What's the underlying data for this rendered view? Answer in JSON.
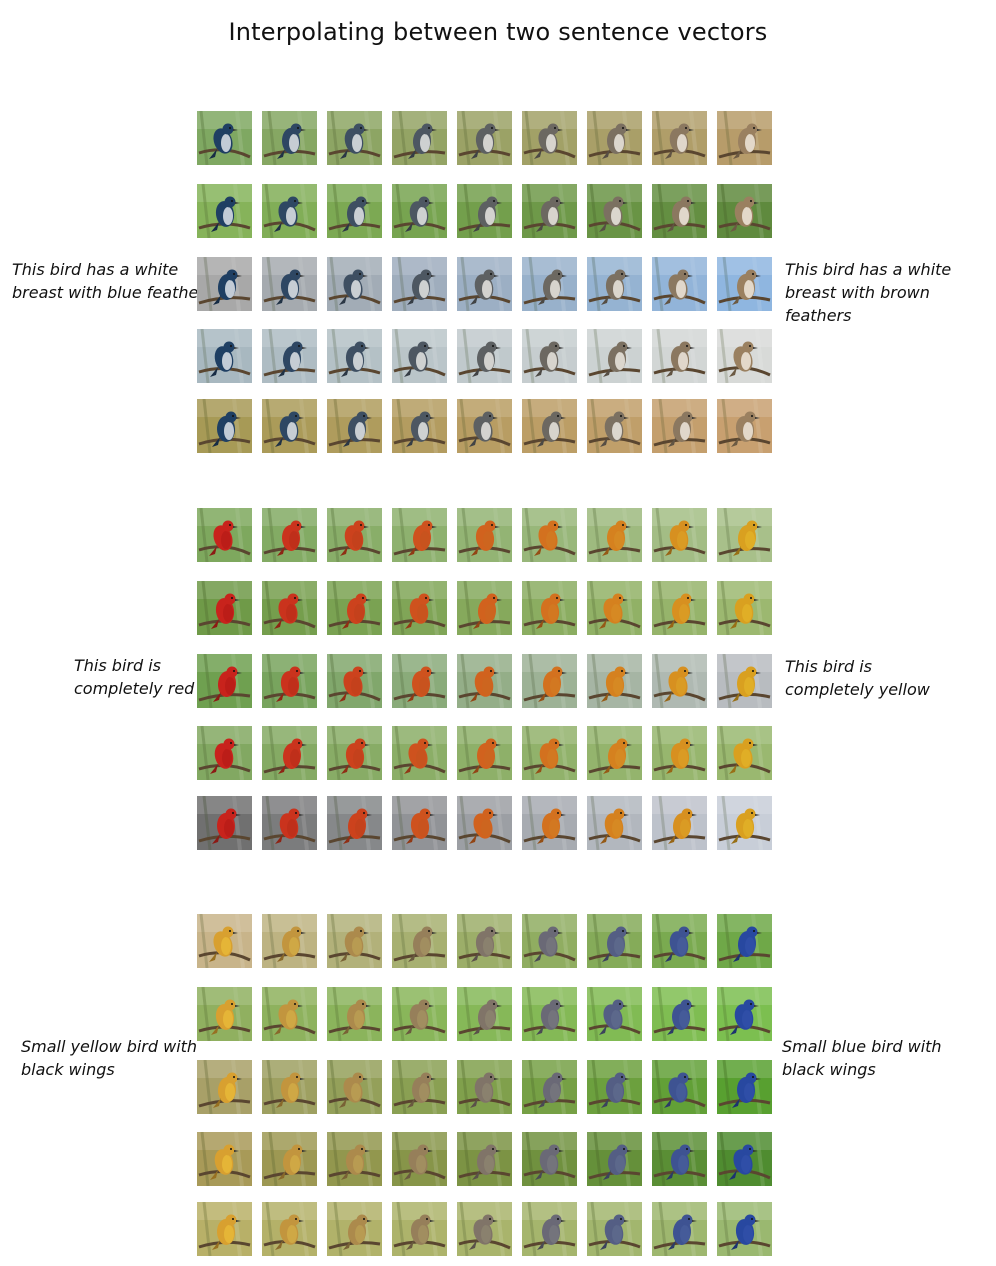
{
  "figure": {
    "title": "Interpolating between two sentence vectors"
  },
  "blocks": [
    {
      "left_label": "This bird has a white\nbreast with blue feathers",
      "right_label": "This bird has a white\nbreast with brown feathers",
      "steps": 9,
      "rows": 5,
      "bird_colors": [
        "#1f3f63",
        "#9a8060"
      ],
      "breast_colors": [
        "#dfe4ea",
        "#f0e8dc"
      ],
      "background_rows": [
        [
          "#7fa862",
          "#b79c6a"
        ],
        [
          "#86b35a",
          "#5f8a3e"
        ],
        [
          "#a8a8a8",
          "#8fb6e0"
        ],
        [
          "#a8b8c0",
          "#d8dad8"
        ],
        [
          "#a79a56",
          "#c8a070"
        ]
      ]
    },
    {
      "left_label": "This bird is\ncompletely red",
      "right_label": "This bird is\ncompletely yellow",
      "steps": 9,
      "rows": 5,
      "bird_colors": [
        "#c8231c",
        "#d9a020"
      ],
      "breast_colors": [
        "#b81c18",
        "#e0b028"
      ],
      "background_rows": [
        [
          "#7ea85e",
          "#a8c08a"
        ],
        [
          "#6f9a48",
          "#9cb870"
        ],
        [
          "#6fa050",
          "#b8bcc0"
        ],
        [
          "#82a862",
          "#9ab870"
        ],
        [
          "#707070",
          "#c8ced8"
        ]
      ]
    },
    {
      "left_label": "Small yellow bird with\nblack wings",
      "right_label": "Small blue bird with\nblack wings",
      "steps": 9,
      "rows": 5,
      "bird_colors": [
        "#d8a030",
        "#2848a0"
      ],
      "breast_colors": [
        "#e8b838",
        "#3050a8"
      ],
      "background_rows": [
        [
          "#c8b48a",
          "#6fa848"
        ],
        [
          "#90b060",
          "#7cbf50"
        ],
        [
          "#a8a068",
          "#58a030"
        ],
        [
          "#a89a58",
          "#4f8c30"
        ],
        [
          "#b8b068",
          "#9ab870"
        ]
      ]
    }
  ]
}
